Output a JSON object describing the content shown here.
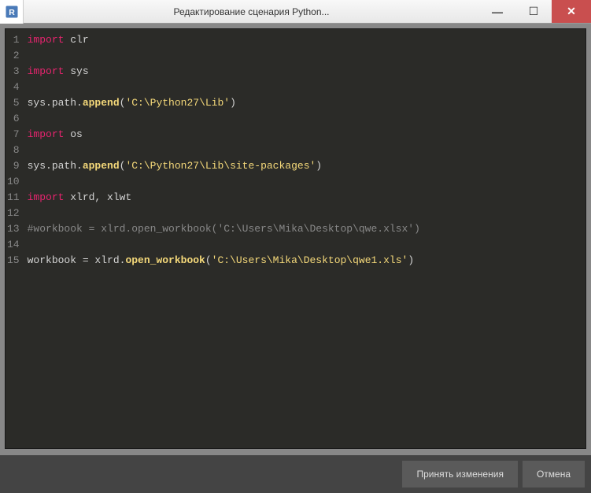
{
  "window": {
    "title": "Редактирование сценария Python..."
  },
  "code": {
    "lines": [
      {
        "n": 1,
        "t": "import",
        "kw": "import",
        "rest": " clr"
      },
      {
        "n": 2,
        "t": "blank"
      },
      {
        "n": 3,
        "t": "import",
        "kw": "import",
        "rest": " sys"
      },
      {
        "n": 4,
        "t": "blank"
      },
      {
        "n": 5,
        "t": "call",
        "pre": "sys.path.",
        "fn": "append",
        "mid": "(",
        "str": "'C:\\Python27\\Lib'",
        "end": ")"
      },
      {
        "n": 6,
        "t": "blank"
      },
      {
        "n": 7,
        "t": "import",
        "kw": "import",
        "rest": " os"
      },
      {
        "n": 8,
        "t": "blank"
      },
      {
        "n": 9,
        "t": "call",
        "pre": "sys.path.",
        "fn": "append",
        "mid": "(",
        "str": "'C:\\Python27\\Lib\\site-packages'",
        "end": ")"
      },
      {
        "n": 10,
        "t": "blank"
      },
      {
        "n": 11,
        "t": "import",
        "kw": "import",
        "rest": " xlrd, xlwt"
      },
      {
        "n": 12,
        "t": "blank"
      },
      {
        "n": 13,
        "t": "comment",
        "text": "#workbook = xlrd.open_workbook('C:\\Users\\Mika\\Desktop\\qwe.xlsx')"
      },
      {
        "n": 14,
        "t": "blank"
      },
      {
        "n": 15,
        "t": "call",
        "pre": "workbook = xlrd.",
        "fn": "open_workbook",
        "mid": "(",
        "str": "'C:\\Users\\Mika\\Desktop\\qwe1.xls'",
        "end": ")"
      }
    ]
  },
  "footer": {
    "accept": "Принять изменения",
    "cancel": "Отмена"
  }
}
